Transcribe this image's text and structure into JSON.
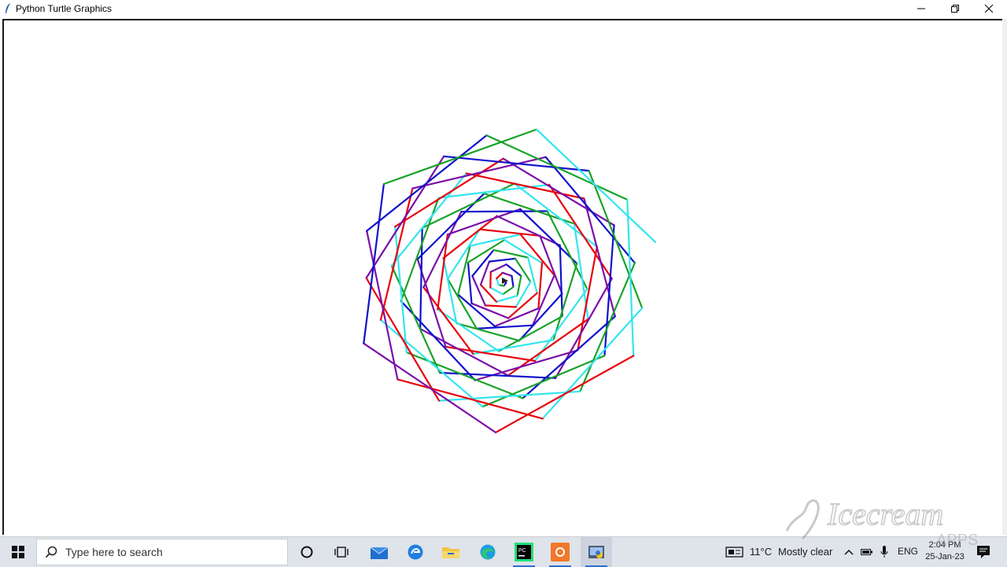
{
  "window": {
    "title": "Python Turtle Graphics"
  },
  "drawing": {
    "pen_colors": [
      "#e8000b",
      "#7a0ea8",
      "#1111cc",
      "#19a32a",
      "#33e5ee"
    ],
    "sides": 6,
    "background": "#ffffff"
  },
  "taskbar": {
    "search_placeholder": "Type here to search",
    "pinned_icons": [
      "task-view-icon",
      "multitasking-icon",
      "mail-icon",
      "edge-legacy-icon",
      "file-explorer-icon",
      "edge-icon",
      "pycharm-icon",
      "recorder-icon",
      "python-turtle-icon"
    ]
  },
  "tray": {
    "temperature": "11°C",
    "weather": "Mostly clear",
    "language": "ENG",
    "time": "2:04 PM",
    "date": "25-Jan-23"
  },
  "watermark": {
    "text": "Icecream APPS"
  }
}
